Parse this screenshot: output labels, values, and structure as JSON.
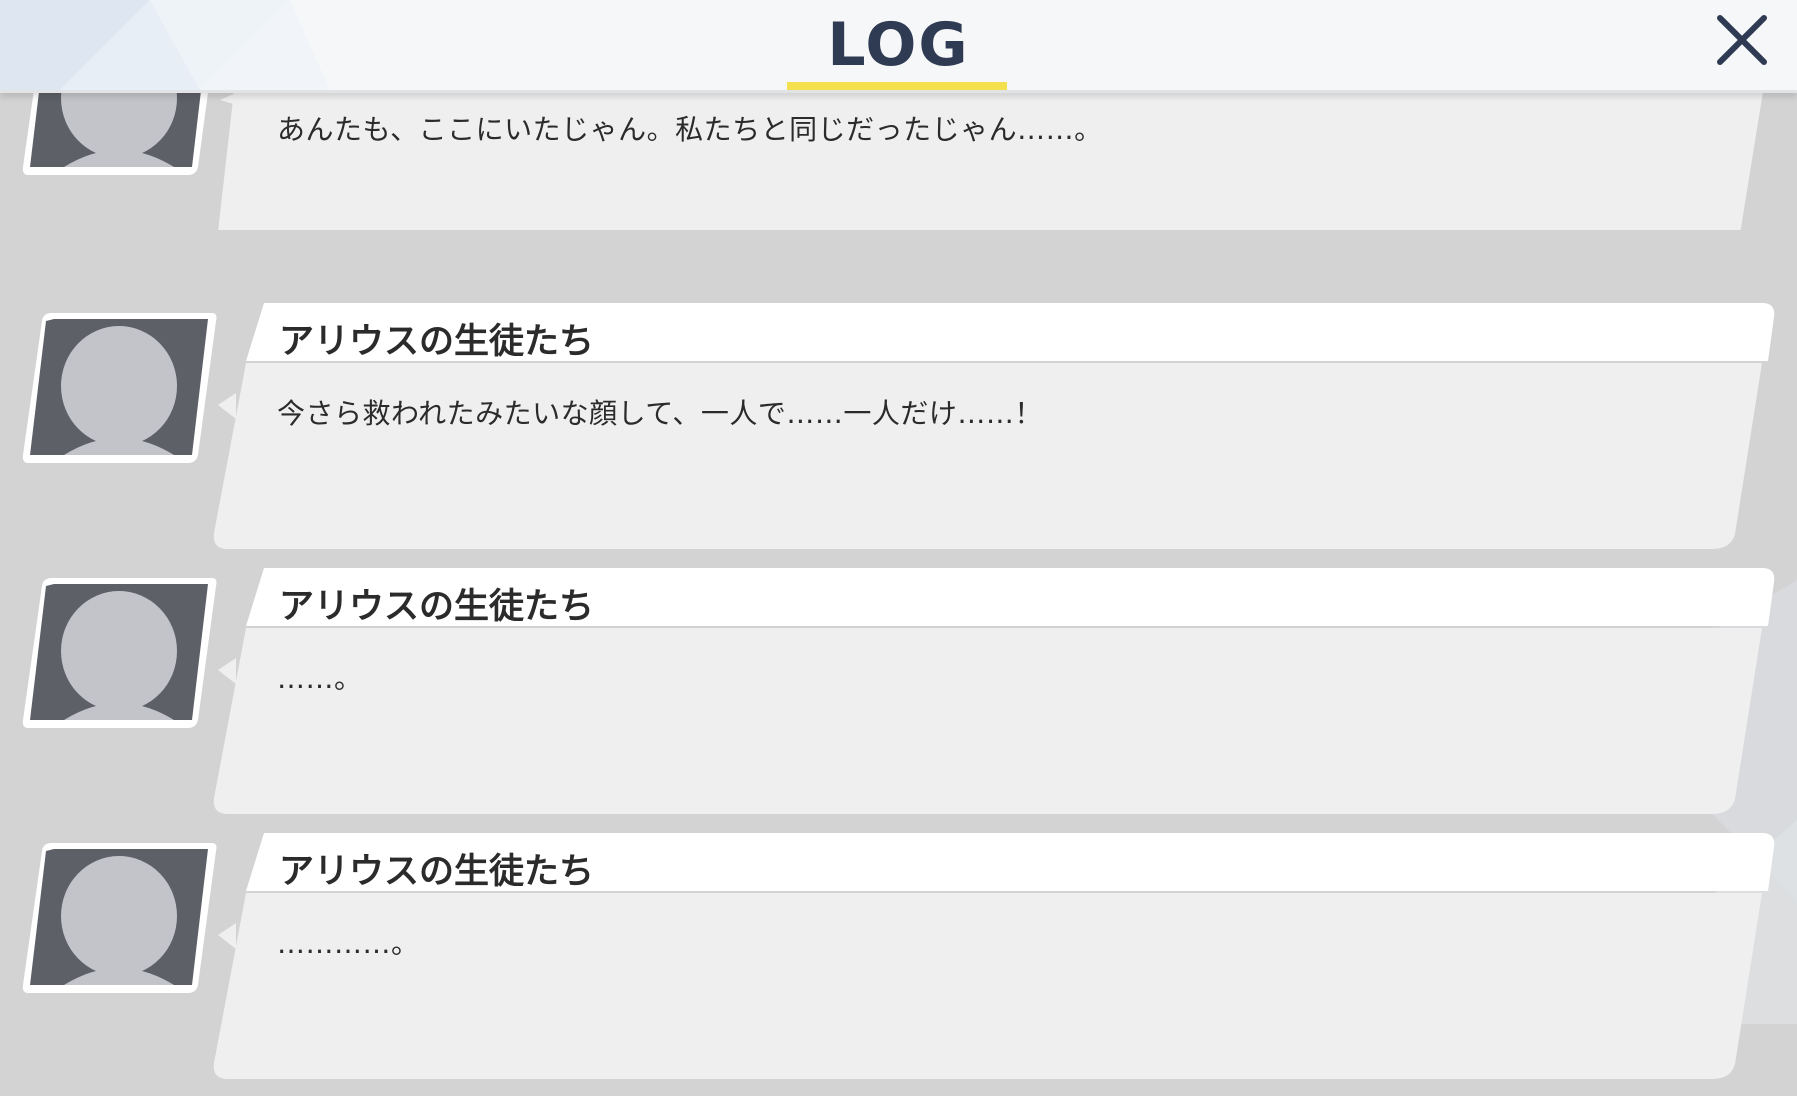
{
  "header": {
    "title": "LOG",
    "close_icon": "close-icon",
    "accent_color": "#f4e04d",
    "title_color": "#2e3b52"
  },
  "entries": [
    {
      "speaker": "",
      "text": "あんたも、ここにいたじゃん。私たちと同じだったじゃん……。",
      "avatar": "placeholder-avatar-icon"
    },
    {
      "speaker": "アリウスの生徒たち",
      "text": "今さら救われたみたいな顔して、一人で……一人だけ……！",
      "avatar": "placeholder-avatar-icon"
    },
    {
      "speaker": "アリウスの生徒たち",
      "text": "……。",
      "avatar": "placeholder-avatar-icon"
    },
    {
      "speaker": "アリウスの生徒たち",
      "text": "…………。",
      "avatar": "placeholder-avatar-icon"
    }
  ]
}
